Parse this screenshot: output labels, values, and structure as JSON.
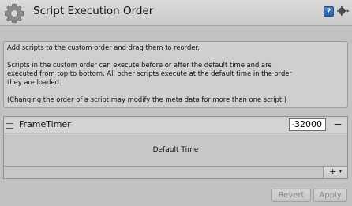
{
  "header": {
    "title": "Script Execution Order",
    "icon": "gear-icon",
    "help_icon": "help-icon",
    "help_glyph": "?",
    "settings_icon": "settings-gear-icon"
  },
  "info": {
    "line1": "Add scripts to the custom order and drag them to reorder.",
    "line2": "Scripts in the custom order can execute before or after the default time and are",
    "line3": "executed from top to bottom. All other scripts execute at the default time in the order",
    "line4": "they are loaded.",
    "line5": "(Changing the order of a script may modify the meta data for more than one script.)"
  },
  "order_list": {
    "rows": [
      {
        "name": "FrameTimer",
        "order": "-32000",
        "remove_label": "−"
      }
    ],
    "default_time_label": "Default Time",
    "add_label": "+",
    "add_caret": "▾"
  },
  "buttons": {
    "revert": "Revert",
    "apply": "Apply"
  },
  "colors": {
    "background": "#c2c2c2",
    "help_blue": "#2a5fa3"
  }
}
